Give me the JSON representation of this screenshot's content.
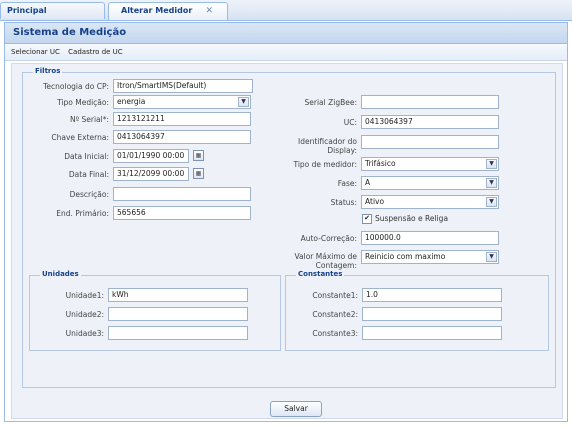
{
  "tabs": [
    {
      "label": "Principal"
    },
    {
      "label": "Alterar Medidor",
      "close": "✕"
    }
  ],
  "window": {
    "title": "Sistema de Medição",
    "toolbar": {
      "item1": "Selecionar UC",
      "item2": "Cadastro de UC"
    }
  },
  "filtros": {
    "legend": "Filtros",
    "left": {
      "tecnologia_label": "Tecnologia do CP:",
      "tecnologia_value": "Itron/SmartIMS(Default)",
      "tipo_medicao_label": "Tipo Medição:",
      "tipo_medicao_value": "energia",
      "num_serial_label": "Nº Serial*:",
      "num_serial_value": "1213121211",
      "chave_externa_label": "Chave Externa:",
      "chave_externa_value": "0413064397",
      "data_inicial_label": "Data Inicial:",
      "data_inicial_value": "01/01/1990 00:00",
      "data_final_label": "Data Final:",
      "data_final_value": "31/12/2099 00:00",
      "descricao_label": "Descrição:",
      "descricao_value": "",
      "end_primario_label": "End. Primário:",
      "end_primario_value": "565656"
    },
    "right": {
      "serial_zigbee_label": "Serial ZigBee:",
      "serial_zigbee_value": "",
      "uc_label": "UC:",
      "uc_value": "0413064397",
      "identificador_label_1": "Identificador do",
      "identificador_label_2": "Display:",
      "identificador_value": "",
      "tipo_medidor_label": "Tipo de medidor:",
      "tipo_medidor_value": "Trifásico",
      "fase_label": "Fase:",
      "fase_value": "A",
      "status_label": "Status:",
      "status_value": "Ativo",
      "suspensao_label": "Suspensão e Religa",
      "suspensao_checked": true,
      "auto_correcao_label": "Auto-Correção:",
      "auto_correcao_value": "100000.0",
      "valor_max_label_1": "Valor Máximo de",
      "valor_max_label_2": "Contagem:",
      "valor_max_value": "Reinicio com maximo"
    }
  },
  "unidades": {
    "legend": "Unidades",
    "u1_label": "Unidade1:",
    "u1_value": "kWh",
    "u2_label": "Unidade2:",
    "u2_value": "",
    "u3_label": "Unidade3:",
    "u3_value": ""
  },
  "constantes": {
    "legend": "Constantes",
    "c1_label": "Constante1:",
    "c1_value": "1.0",
    "c2_label": "Constante2:",
    "c2_value": "",
    "c3_label": "Constante3:",
    "c3_value": ""
  },
  "actions": {
    "save_label": "Salvar"
  },
  "icons": {
    "dropdown": "chevron-down-icon",
    "calendar": "calendar-icon",
    "check": "checkbox-checked-icon"
  }
}
